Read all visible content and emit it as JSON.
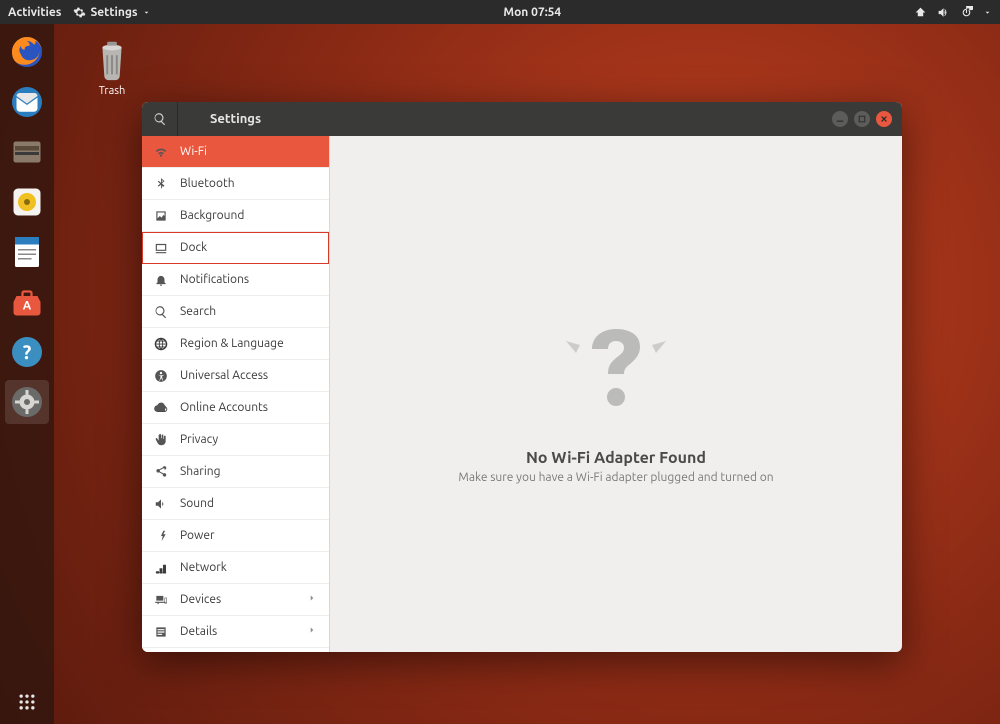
{
  "topbar": {
    "activities": "Activities",
    "app_menu": "Settings",
    "clock": "Mon 07:54"
  },
  "desktop": {
    "trash_label": "Trash"
  },
  "window": {
    "title": "Settings"
  },
  "sidebar": {
    "items": [
      {
        "id": "wifi",
        "label": "Wi-Fi",
        "icon": "wifi-icon",
        "active": true
      },
      {
        "id": "bluetooth",
        "label": "Bluetooth",
        "icon": "bluetooth-icon"
      },
      {
        "id": "background",
        "label": "Background",
        "icon": "background-icon"
      },
      {
        "id": "dock",
        "label": "Dock",
        "icon": "dock-icon",
        "highlighted": true
      },
      {
        "id": "notifications",
        "label": "Notifications",
        "icon": "bell-icon"
      },
      {
        "id": "search",
        "label": "Search",
        "icon": "search-icon"
      },
      {
        "id": "region",
        "label": "Region & Language",
        "icon": "globe-icon"
      },
      {
        "id": "universal",
        "label": "Universal Access",
        "icon": "accessibility-icon"
      },
      {
        "id": "online",
        "label": "Online Accounts",
        "icon": "cloud-icon"
      },
      {
        "id": "privacy",
        "label": "Privacy",
        "icon": "hand-icon"
      },
      {
        "id": "sharing",
        "label": "Sharing",
        "icon": "share-icon"
      },
      {
        "id": "sound",
        "label": "Sound",
        "icon": "sound-icon"
      },
      {
        "id": "power",
        "label": "Power",
        "icon": "power-icon"
      },
      {
        "id": "network",
        "label": "Network",
        "icon": "network-icon"
      },
      {
        "id": "devices",
        "label": "Devices",
        "icon": "devices-icon",
        "expandable": true
      },
      {
        "id": "details",
        "label": "Details",
        "icon": "details-icon",
        "expandable": true
      }
    ]
  },
  "content": {
    "heading": "No Wi-Fi Adapter Found",
    "subtext": "Make sure you have a Wi-Fi adapter plugged and turned on"
  },
  "dock_apps": [
    {
      "id": "firefox",
      "name": "firefox-icon"
    },
    {
      "id": "thunderbird",
      "name": "thunderbird-icon"
    },
    {
      "id": "files",
      "name": "files-icon"
    },
    {
      "id": "rhythmbox",
      "name": "rhythmbox-icon"
    },
    {
      "id": "writer",
      "name": "writer-icon"
    },
    {
      "id": "software",
      "name": "software-icon"
    },
    {
      "id": "help",
      "name": "help-icon"
    },
    {
      "id": "settings",
      "name": "settings-icon",
      "active": true
    }
  ]
}
